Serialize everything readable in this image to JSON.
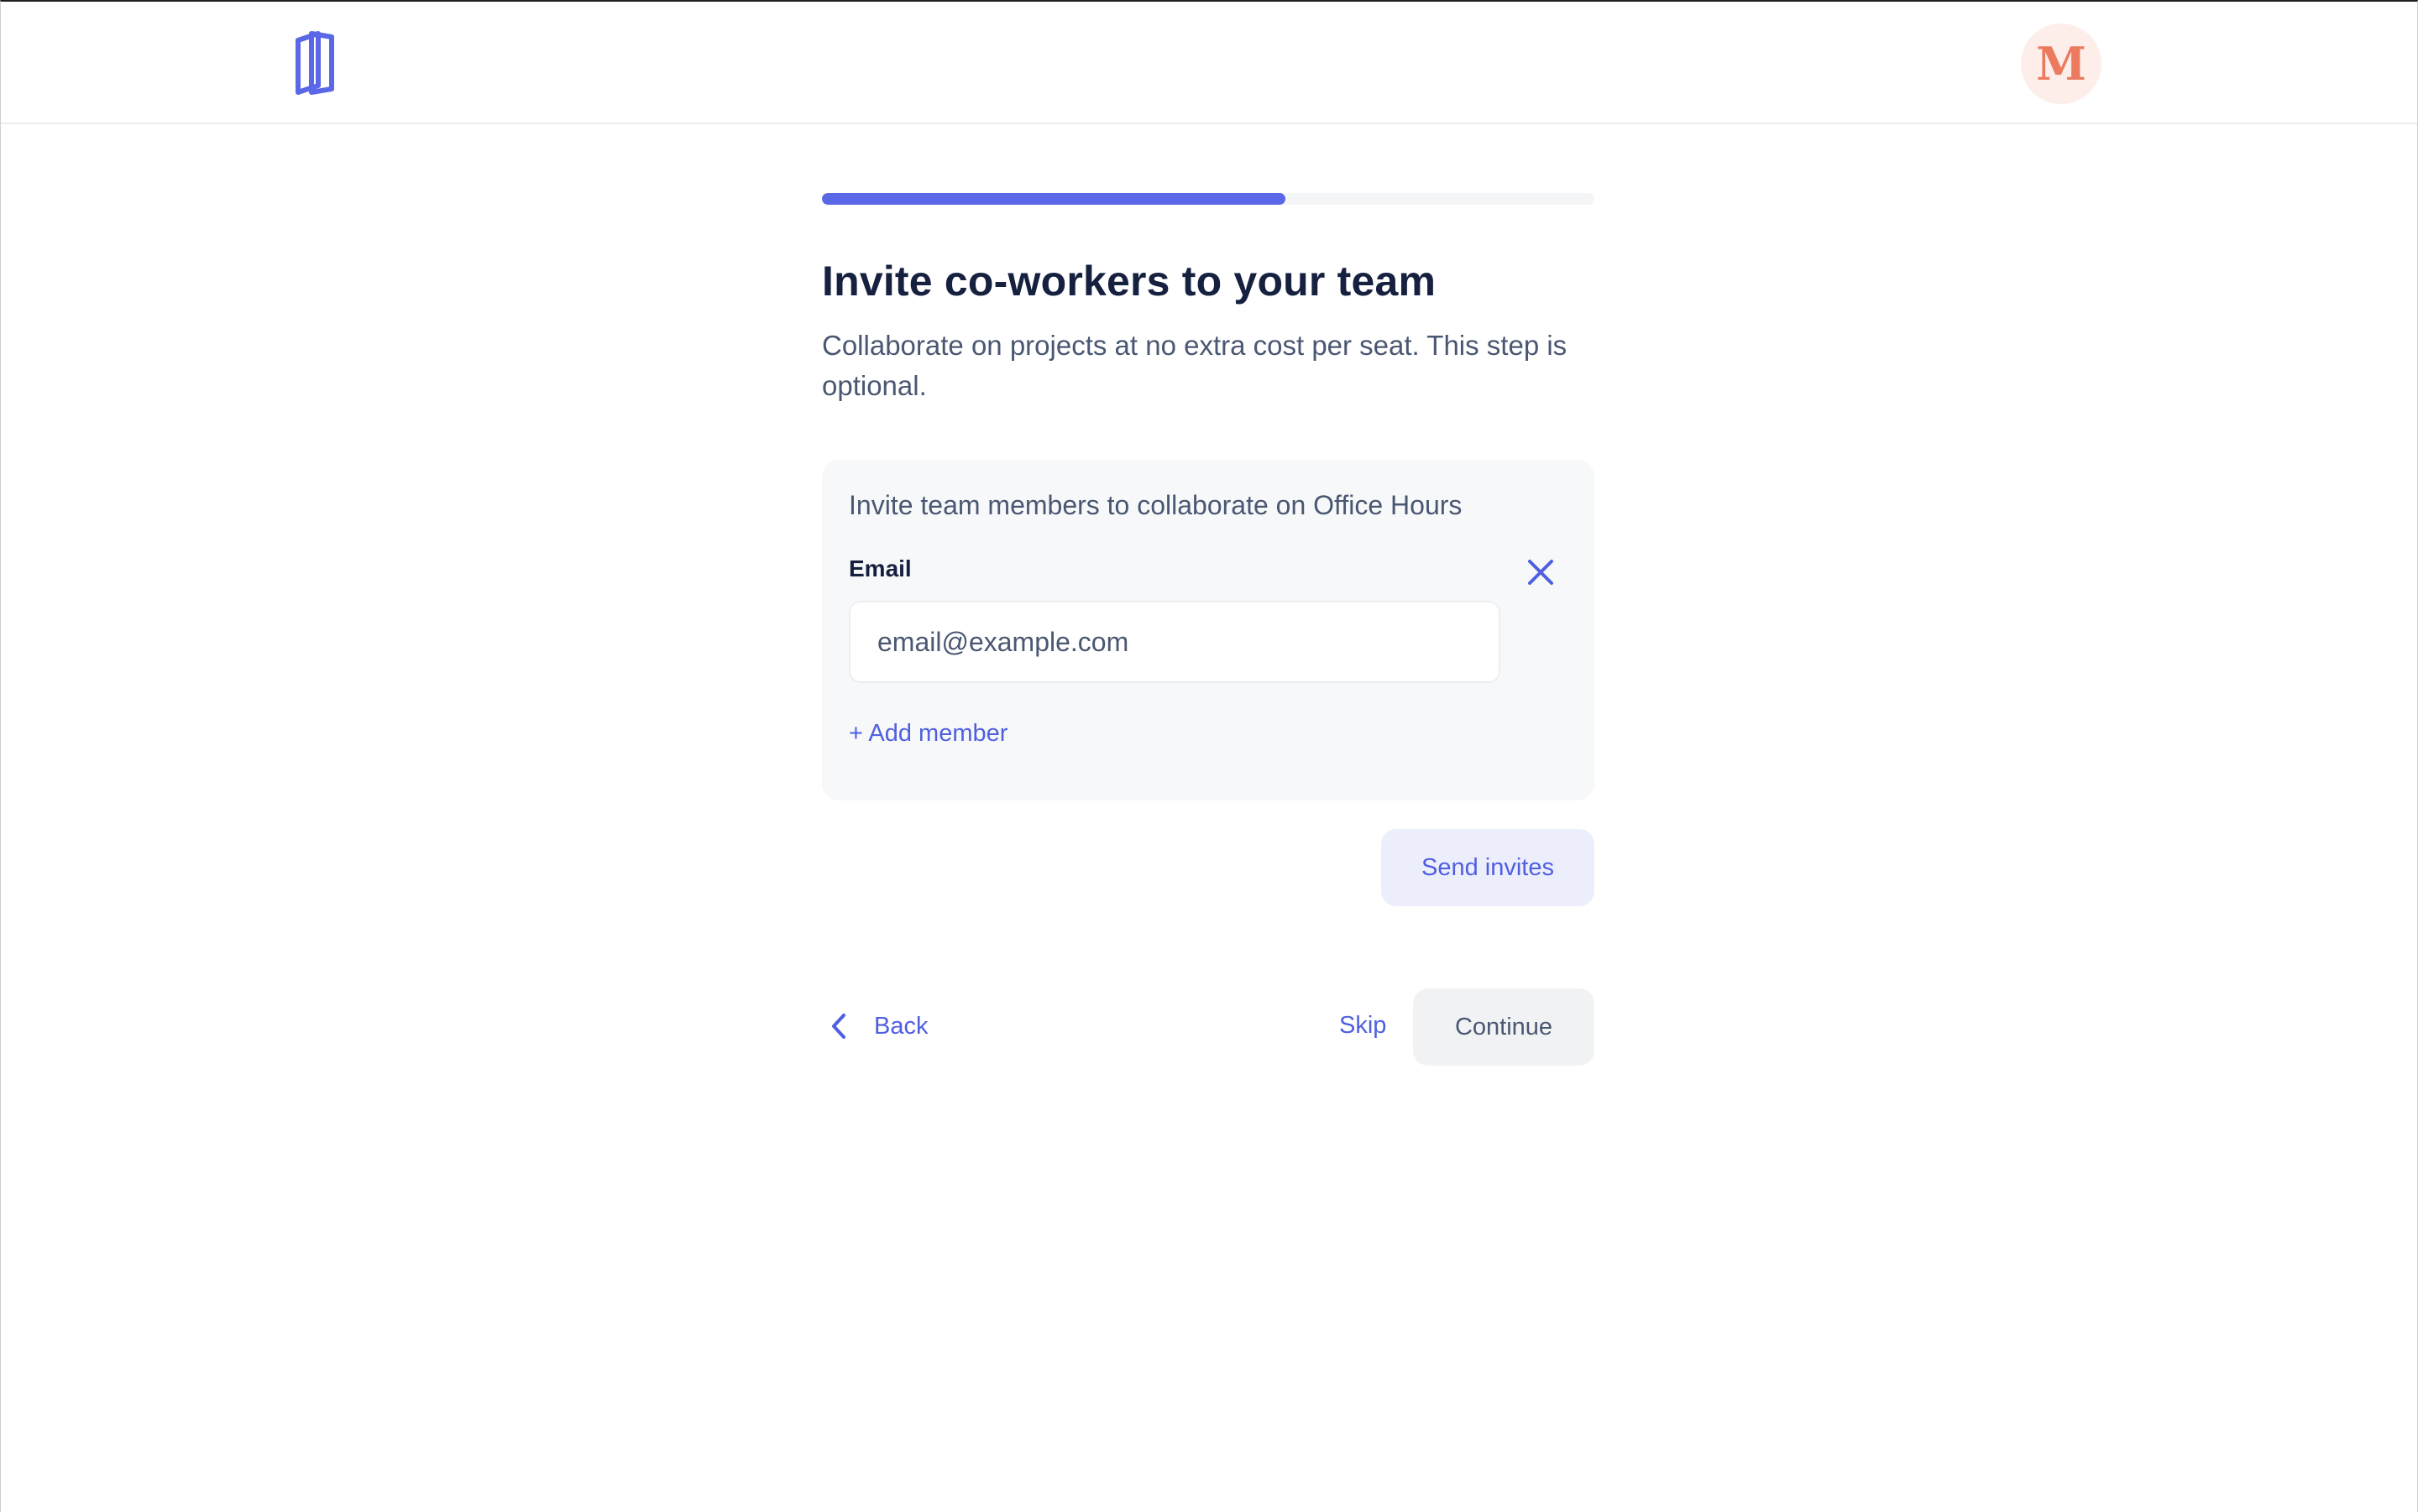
{
  "header": {
    "logo_icon": "book-logo-icon",
    "avatar_initial": "M",
    "colors": {
      "logo": "#5a67e6",
      "avatar_bg": "#fdeeea",
      "avatar_fg": "#ec7a5e"
    }
  },
  "progress": {
    "value_percent": 60,
    "color": "#5a67e6"
  },
  "page": {
    "title": "Invite co-workers to your team",
    "subtitle": "Collaborate on projects at no extra cost per seat. This step is optional."
  },
  "invite_card": {
    "heading": "Invite team members to collaborate on Office Hours",
    "email_label": "Email",
    "email_value": "",
    "email_placeholder": "email@example.com",
    "remove_icon": "close-icon",
    "add_member_label": "+ Add member"
  },
  "actions": {
    "send_invites_label": "Send invites",
    "back_label": "Back",
    "back_icon": "chevron-left-icon",
    "skip_label": "Skip",
    "continue_label": "Continue"
  },
  "theme": {
    "accent": "#4f5fe0",
    "title_color": "#16203f",
    "body_text": "#4a5772"
  }
}
